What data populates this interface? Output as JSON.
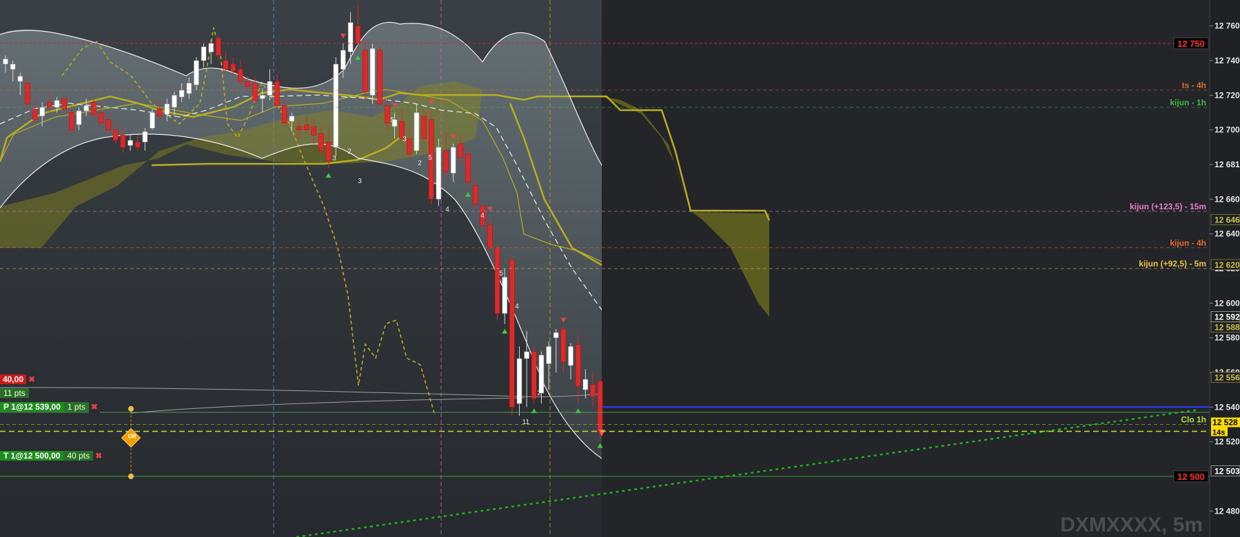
{
  "chart_data": {
    "type": "candlestick",
    "symbol_watermark": "DXMXXXX, 5m",
    "y_axis": {
      "range": [
        12465,
        12775
      ],
      "ticks": [
        12760,
        12740,
        12720,
        12700,
        12680,
        12660,
        12640,
        12620,
        12600,
        12580,
        12560,
        12540,
        12520,
        12480
      ],
      "tick_labels": [
        "12 760",
        "12 740",
        "12 720",
        "12 700",
        "12 681",
        "12 660",
        "12 640",
        "12 620",
        "12 600",
        "12 580",
        "12 560",
        "12 540",
        "12 520",
        "12 480"
      ],
      "markers": [
        {
          "value": 12648,
          "label": "12 646",
          "color": "#c9c050"
        },
        {
          "value": 12622,
          "label": "12 620",
          "color": "#c9c050"
        },
        {
          "value": 12592,
          "label": "12 592",
          "color": "#ffffff"
        },
        {
          "value": 12586,
          "label": "12 588",
          "color": "#c9c050"
        },
        {
          "value": 12557,
          "label": "12 556",
          "color": "#c9c050"
        },
        {
          "value": 12530,
          "label": "12 528",
          "color": "#ffdd00",
          "highlight": true
        },
        {
          "value": 12503,
          "label": "12 503",
          "color": "#ffffff"
        }
      ]
    },
    "price_boxes": [
      {
        "value": 12750,
        "label": "12 750"
      },
      {
        "value": 12500,
        "label": "12 500"
      }
    ],
    "countdown": "14s",
    "level_labels": [
      {
        "value": 12723,
        "label": "ts - 4h",
        "color": "#e06a2a"
      },
      {
        "value": 12713,
        "label": "kijun - 1h",
        "color": "#41b84a"
      },
      {
        "value": 12653,
        "label": "kijun (+123,5) - 15m",
        "color": "#e87ec8"
      },
      {
        "value": 12632,
        "label": "kijun - 4h",
        "color": "#e06a2a"
      },
      {
        "value": 12620,
        "label": "kijun (+92,5) - 5m",
        "color": "#e8c44a"
      },
      {
        "value": 12530,
        "label": "Clo 1h",
        "color": "#b8e030"
      }
    ],
    "candles": [
      {
        "o": 12738,
        "h": 12743,
        "l": 12733,
        "c": 12741
      },
      {
        "o": 12735,
        "h": 12740,
        "l": 12728,
        "c": 12738
      },
      {
        "o": 12728,
        "h": 12733,
        "l": 12720,
        "c": 12731
      },
      {
        "o": 12727,
        "h": 12730,
        "l": 12712,
        "c": 12715
      },
      {
        "o": 12712,
        "h": 12718,
        "l": 12704,
        "c": 12706
      },
      {
        "o": 12708,
        "h": 12716,
        "l": 12702,
        "c": 12713
      },
      {
        "o": 12716,
        "h": 12721,
        "l": 12710,
        "c": 12713
      },
      {
        "o": 12713,
        "h": 12719,
        "l": 12710,
        "c": 12717
      },
      {
        "o": 12718,
        "h": 12720,
        "l": 12710,
        "c": 12712
      },
      {
        "o": 12710,
        "h": 12714,
        "l": 12698,
        "c": 12700
      },
      {
        "o": 12703,
        "h": 12713,
        "l": 12700,
        "c": 12711
      },
      {
        "o": 12711,
        "h": 12718,
        "l": 12708,
        "c": 12714
      },
      {
        "o": 12716,
        "h": 12718,
        "l": 12707,
        "c": 12709
      },
      {
        "o": 12710,
        "h": 12716,
        "l": 12702,
        "c": 12704
      },
      {
        "o": 12706,
        "h": 12710,
        "l": 12698,
        "c": 12700
      },
      {
        "o": 12700,
        "h": 12704,
        "l": 12692,
        "c": 12694
      },
      {
        "o": 12697,
        "h": 12702,
        "l": 12687,
        "c": 12690
      },
      {
        "o": 12691,
        "h": 12697,
        "l": 12688,
        "c": 12694
      },
      {
        "o": 12693,
        "h": 12697,
        "l": 12688,
        "c": 12690
      },
      {
        "o": 12693,
        "h": 12701,
        "l": 12688,
        "c": 12699
      },
      {
        "o": 12701,
        "h": 12712,
        "l": 12700,
        "c": 12710
      },
      {
        "o": 12712,
        "h": 12718,
        "l": 12706,
        "c": 12708
      },
      {
        "o": 12709,
        "h": 12718,
        "l": 12705,
        "c": 12715
      },
      {
        "o": 12713,
        "h": 12722,
        "l": 12708,
        "c": 12720
      },
      {
        "o": 12719,
        "h": 12727,
        "l": 12716,
        "c": 12723
      },
      {
        "o": 12721,
        "h": 12730,
        "l": 12718,
        "c": 12727
      },
      {
        "o": 12726,
        "h": 12742,
        "l": 12723,
        "c": 12740
      },
      {
        "o": 12740,
        "h": 12750,
        "l": 12736,
        "c": 12748
      },
      {
        "o": 12745,
        "h": 12752,
        "l": 12738,
        "c": 12750
      },
      {
        "o": 12753,
        "h": 12754,
        "l": 12741,
        "c": 12743
      },
      {
        "o": 12740,
        "h": 12745,
        "l": 12733,
        "c": 12735
      },
      {
        "o": 12738,
        "h": 12742,
        "l": 12732,
        "c": 12734
      },
      {
        "o": 12735,
        "h": 12740,
        "l": 12725,
        "c": 12728
      },
      {
        "o": 12728,
        "h": 12731,
        "l": 12722,
        "c": 12725
      },
      {
        "o": 12727,
        "h": 12731,
        "l": 12715,
        "c": 12717
      },
      {
        "o": 12718,
        "h": 12724,
        "l": 12710,
        "c": 12720
      },
      {
        "o": 12720,
        "h": 12735,
        "l": 12717,
        "c": 12728
      },
      {
        "o": 12728,
        "h": 12732,
        "l": 12712,
        "c": 12714
      },
      {
        "o": 12714,
        "h": 12718,
        "l": 12702,
        "c": 12704
      },
      {
        "o": 12705,
        "h": 12710,
        "l": 12699,
        "c": 12708
      },
      {
        "o": 12702,
        "h": 12706,
        "l": 12695,
        "c": 12700
      },
      {
        "o": 12703,
        "h": 12708,
        "l": 12698,
        "c": 12700
      },
      {
        "o": 12702,
        "h": 12707,
        "l": 12692,
        "c": 12697
      },
      {
        "o": 12698,
        "h": 12702,
        "l": 12685,
        "c": 12688
      },
      {
        "o": 12693,
        "h": 12702,
        "l": 12678,
        "c": 12682
      },
      {
        "o": 12690,
        "h": 12742,
        "l": 12685,
        "c": 12738
      },
      {
        "o": 12735,
        "h": 12750,
        "l": 12730,
        "c": 12746
      },
      {
        "o": 12745,
        "h": 12768,
        "l": 12738,
        "c": 12762
      },
      {
        "o": 12760,
        "h": 12772,
        "l": 12746,
        "c": 12750
      },
      {
        "o": 12746,
        "h": 12752,
        "l": 12718,
        "c": 12722
      },
      {
        "o": 12720,
        "h": 12750,
        "l": 12715,
        "c": 12747
      },
      {
        "o": 12746,
        "h": 12748,
        "l": 12712,
        "c": 12715
      },
      {
        "o": 12714,
        "h": 12718,
        "l": 12700,
        "c": 12704
      },
      {
        "o": 12702,
        "h": 12710,
        "l": 12695,
        "c": 12706
      },
      {
        "o": 12705,
        "h": 12712,
        "l": 12692,
        "c": 12695
      },
      {
        "o": 12695,
        "h": 12702,
        "l": 12683,
        "c": 12686
      },
      {
        "o": 12688,
        "h": 12715,
        "l": 12686,
        "c": 12710
      },
      {
        "o": 12708,
        "h": 12712,
        "l": 12692,
        "c": 12695
      },
      {
        "o": 12706,
        "h": 12712,
        "l": 12657,
        "c": 12660
      },
      {
        "o": 12660,
        "h": 12695,
        "l": 12656,
        "c": 12690
      },
      {
        "o": 12688,
        "h": 12699,
        "l": 12672,
        "c": 12676
      },
      {
        "o": 12675,
        "h": 12692,
        "l": 12670,
        "c": 12690
      },
      {
        "o": 12692,
        "h": 12697,
        "l": 12680,
        "c": 12684
      },
      {
        "o": 12686,
        "h": 12690,
        "l": 12667,
        "c": 12670
      },
      {
        "o": 12668,
        "h": 12672,
        "l": 12655,
        "c": 12657
      },
      {
        "o": 12656,
        "h": 12658,
        "l": 12642,
        "c": 12645
      },
      {
        "o": 12645,
        "h": 12650,
        "l": 12628,
        "c": 12632
      },
      {
        "o": 12632,
        "h": 12634,
        "l": 12590,
        "c": 12594
      },
      {
        "o": 12594,
        "h": 12620,
        "l": 12588,
        "c": 12615
      },
      {
        "o": 12625,
        "h": 12628,
        "l": 12535,
        "c": 12540
      },
      {
        "o": 12542,
        "h": 12575,
        "l": 12535,
        "c": 12568
      },
      {
        "o": 12568,
        "h": 12584,
        "l": 12540,
        "c": 12572
      },
      {
        "o": 12572,
        "h": 12575,
        "l": 12542,
        "c": 12545
      },
      {
        "o": 12548,
        "h": 12572,
        "l": 12542,
        "c": 12570
      },
      {
        "o": 12565,
        "h": 12578,
        "l": 12550,
        "c": 12575
      },
      {
        "o": 12580,
        "h": 12585,
        "l": 12560,
        "c": 12583
      },
      {
        "o": 12585,
        "h": 12586,
        "l": 12560,
        "c": 12566
      },
      {
        "o": 12564,
        "h": 12577,
        "l": 12556,
        "c": 12575
      },
      {
        "o": 12576,
        "h": 12582,
        "l": 12542,
        "c": 12552
      },
      {
        "o": 12550,
        "h": 12562,
        "l": 12545,
        "c": 12556
      },
      {
        "o": 12553,
        "h": 12560,
        "l": 12540,
        "c": 12546
      },
      {
        "o": 12555,
        "h": 12556,
        "l": 12522,
        "c": 12526
      }
    ]
  },
  "order_tags": {
    "sell_price": "40,00",
    "sell_pts": "11 pts",
    "stop_label": "P 1@12 539,00",
    "stop_pts": "1 pts",
    "target_label": "T 1@12 500,00",
    "target_pts": "40 pts",
    "close_x": "✖",
    "or_label": "OR"
  },
  "signal_numbers": [
    "3",
    "2",
    "3",
    "5",
    "3",
    "2",
    "5",
    "4",
    "4",
    "5",
    "4",
    "2",
    "11"
  ],
  "colors": {
    "bull": "#ffffff",
    "bear": "#e02828",
    "kumo": "#8a8a1a",
    "kijun": "#b8b020",
    "bollinger": "#f0f0f0",
    "sell_tag": "#cc1b1b",
    "buy_tag": "#1f8c1f"
  }
}
